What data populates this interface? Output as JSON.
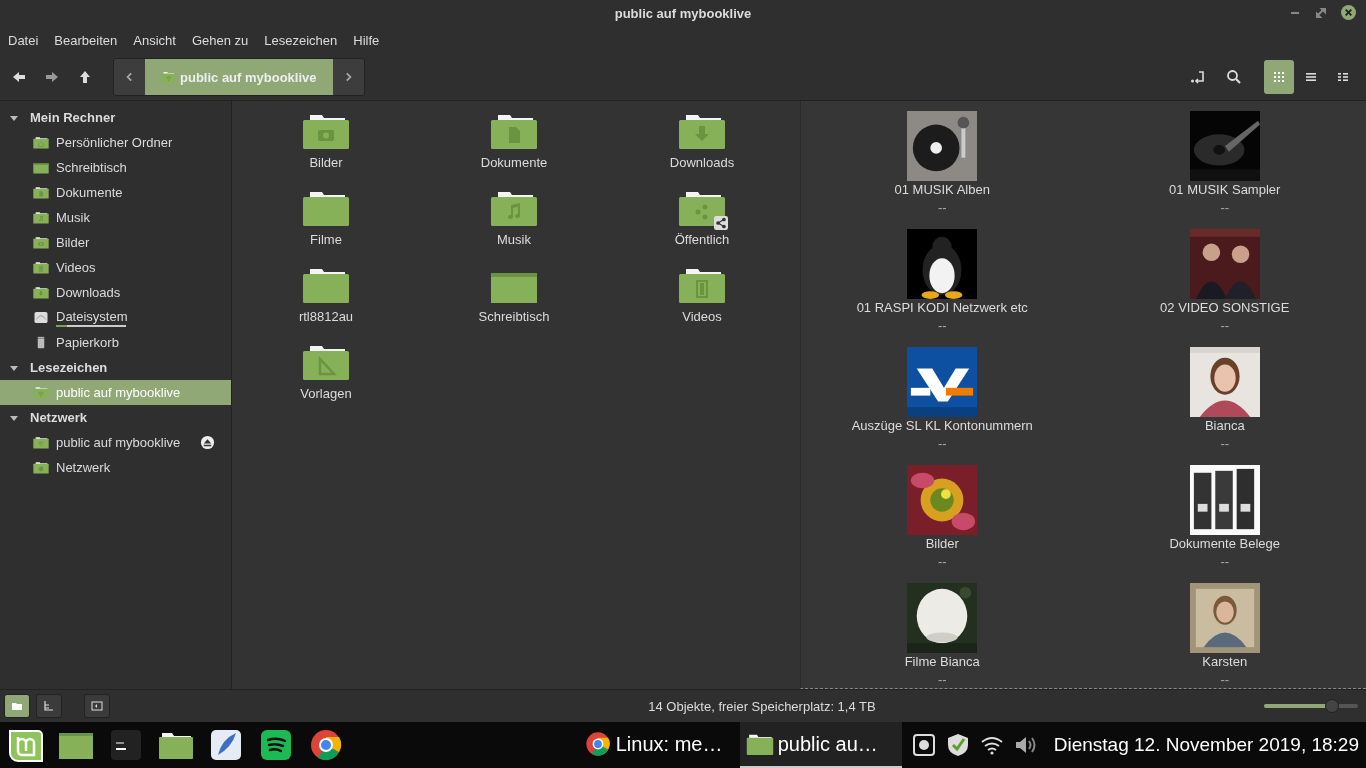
{
  "window": {
    "title": "public auf mybooklive"
  },
  "menu": [
    "Datei",
    "Bearbeiten",
    "Ansicht",
    "Gehen zu",
    "Lesezeichen",
    "Hilfe"
  ],
  "toolbar": {
    "path": [
      {
        "label": "public auf mybooklive",
        "selected": true
      }
    ],
    "views": [
      {
        "kind": "icons",
        "selected": true
      },
      {
        "kind": "list",
        "selected": false
      },
      {
        "kind": "compact",
        "selected": false
      }
    ]
  },
  "sidebar": [
    {
      "title": "Mein Rechner",
      "expanded": true,
      "items": [
        {
          "label": "Persönlicher Ordner",
          "kind": "home",
          "selected": false
        },
        {
          "label": "Schreibtisch",
          "kind": "desktop",
          "selected": false
        },
        {
          "label": "Dokumente",
          "kind": "document",
          "selected": false
        },
        {
          "label": "Musik",
          "kind": "music",
          "selected": false
        },
        {
          "label": "Bilder",
          "kind": "camera",
          "selected": false
        },
        {
          "label": "Videos",
          "kind": "film",
          "selected": false
        },
        {
          "label": "Downloads",
          "kind": "download",
          "selected": false
        },
        {
          "label": "Dateisystem",
          "kind": "drive",
          "selected": false,
          "level": 0.15
        },
        {
          "label": "Papierkorb",
          "kind": "trash",
          "selected": false
        }
      ]
    },
    {
      "title": "Lesezeichen",
      "expanded": true,
      "items": [
        {
          "label": "public auf mybooklive",
          "kind": "network",
          "selected": true
        }
      ]
    },
    {
      "title": "Netzwerk",
      "expanded": true,
      "items": [
        {
          "label": "public auf mybooklive",
          "kind": "network",
          "selected": false,
          "eject": true
        },
        {
          "label": "Netzwerk",
          "kind": "globe",
          "selected": false
        }
      ]
    }
  ],
  "files": [
    {
      "name": "Bilder",
      "kind": "camera"
    },
    {
      "name": "Dokumente",
      "kind": "document"
    },
    {
      "name": "Downloads",
      "kind": "download"
    },
    {
      "name": "Filme",
      "kind": "plain"
    },
    {
      "name": "Musik",
      "kind": "music"
    },
    {
      "name": "Öffentlich",
      "kind": "share"
    },
    {
      "name": "rtl8812au",
      "kind": "plain"
    },
    {
      "name": "Schreibtisch",
      "kind": "desktop"
    },
    {
      "name": "Videos",
      "kind": "film"
    },
    {
      "name": "Vorlagen",
      "kind": "template"
    }
  ],
  "second_pane": [
    {
      "name": "01 MUSIK Alben",
      "info": "--",
      "kind": "picture"
    },
    {
      "name": "01 MUSIK Sampler",
      "info": "--",
      "kind": "picture"
    },
    {
      "name": "01 RASPI KODI Netzwerk etc",
      "info": "--",
      "kind": "picture"
    },
    {
      "name": "02 VIDEO SONSTIGE",
      "info": "--",
      "kind": "picture"
    },
    {
      "name": "Auszüge SL KL Kontonummern",
      "info": "--",
      "kind": "picture"
    },
    {
      "name": "Bianca",
      "info": "--",
      "kind": "picture"
    },
    {
      "name": "Bilder",
      "info": "--",
      "kind": "picture"
    },
    {
      "name": "Dokumente Belege",
      "info": "--",
      "kind": "picture"
    },
    {
      "name": "Filme Bianca",
      "info": "--",
      "kind": "picture"
    },
    {
      "name": "Karsten",
      "info": "--",
      "kind": "picture"
    }
  ],
  "status_bar": {
    "text": "14 Objekte, freier Speicherplatz: 1,4 TB",
    "panes": [
      {
        "kind": "places",
        "selected": true
      },
      {
        "kind": "tree",
        "selected": false
      }
    ],
    "zoom": {
      "level": 0.72
    }
  },
  "taskbar": {
    "launchers": [
      {
        "kind": "mint"
      },
      {
        "kind": "desktop"
      },
      {
        "kind": "terminal"
      },
      {
        "kind": "folder"
      },
      {
        "kind": "mail"
      },
      {
        "kind": "music"
      },
      {
        "kind": "browser"
      }
    ],
    "windows": [
      {
        "title": "Linux: me…",
        "kind": "browser",
        "selected": false
      },
      {
        "title": "public au…",
        "kind": "folder",
        "selected": true
      }
    ],
    "tray": [
      {
        "kind": "drive"
      },
      {
        "kind": "shield"
      },
      {
        "kind": "wifi"
      },
      {
        "kind": "volume"
      }
    ],
    "clock": "Dienstag 12. November 2019, 18:29"
  }
}
